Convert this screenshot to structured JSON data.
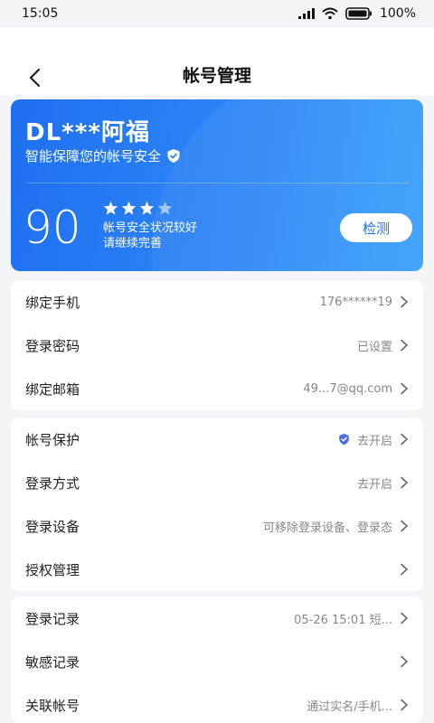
{
  "status": {
    "time": "15:05",
    "battery": "100%"
  },
  "header": {
    "title": "帐号管理"
  },
  "card": {
    "name": "DL***阿福",
    "subtitle": "智能保障您的帐号安全",
    "score": "90",
    "stars_filled": 3,
    "stars_total": 4,
    "desc_line1": "帐号安全状况较好",
    "desc_line2": "请继续完善",
    "button_label": "检测"
  },
  "group1": [
    {
      "label": "绑定手机",
      "value": "176******19"
    },
    {
      "label": "登录密码",
      "value": "已设置"
    },
    {
      "label": "绑定邮箱",
      "value": "49...7@qq.com"
    }
  ],
  "group2": [
    {
      "label": "帐号保护",
      "value": "去开启"
    },
    {
      "label": "登录方式",
      "value": "去开启"
    },
    {
      "label": "登录设备",
      "value": "可移除登录设备、登录态"
    },
    {
      "label": "授权管理",
      "value": ""
    }
  ],
  "group3": [
    {
      "label": "登录记录",
      "value": "05-26 15:01 短..."
    },
    {
      "label": "敏感记录",
      "value": ""
    },
    {
      "label": "关联帐号",
      "value": "通过实名/手机..."
    }
  ],
  "colors": {
    "accent": "#1f6ff0",
    "shield": "#4a6fe3"
  }
}
